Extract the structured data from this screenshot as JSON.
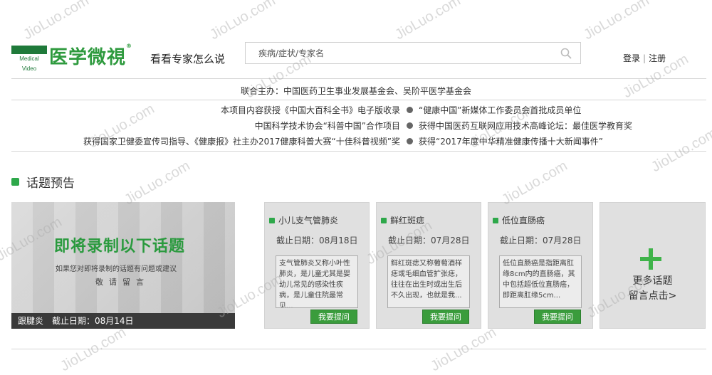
{
  "header": {
    "logo_small": "Medical Video",
    "logo_text": "医学微視",
    "logo_reg": "®",
    "slogan": "看看专家怎么说",
    "search_placeholder": "疾病/症状/专家名",
    "login": "登录",
    "auth_sep": "|",
    "register": "注册"
  },
  "hosts": "联合主办：中国医药卫生事业发展基金会、吴阶平医学基金会",
  "honors": [
    {
      "left": "本项目内容获授《中国大百科全书》电子版收录",
      "right": "“健康中国”新媒体工作委员会首批成员单位"
    },
    {
      "left": "中国科学技术协会“科普中国”合作项目",
      "right": "获得中国医药互联网应用技术高峰论坛：最佳医学教育奖"
    },
    {
      "left": "获得国家卫健委宣传司指导、《健康报》社主办2017健康科普大赛“十佳科普视频”奖",
      "right": "获得“2017年度中华精准健康传播十大新闻事件”"
    }
  ],
  "section": {
    "title": "话题预告"
  },
  "banner": {
    "headline": "即将录制以下话题",
    "subline": "如果您对即将录制的话题有问题或建议",
    "subline2": "敬请留言",
    "footer_topic": "跟腱炎",
    "footer_deadline": "截止日期：08月14日"
  },
  "cards": [
    {
      "title": "小儿支气管肺炎",
      "deadline": "截止日期：08月18日",
      "desc": "支气管肺炎又称小叶性肺炎，是儿童尤其是婴幼儿常见的感染性疾病，是儿童住院最常见...",
      "button": "我要提问"
    },
    {
      "title": "鲜红斑痣",
      "deadline": "截止日期：07月28日",
      "desc": "鲜红斑痣又称葡萄酒样痣或毛细血管扩张痣，往往在出生时或出生后不久出现，也就是我...",
      "button": "我要提问"
    },
    {
      "title": "低位直肠癌",
      "deadline": "截止日期：07月28日",
      "desc": "低位直肠癌是指距离肛缘8cm内的直肠癌，其中包括超低位直肠癌，即距离肛缘5cm...",
      "button": "我要提问"
    }
  ],
  "more": {
    "line1": "更多话题",
    "line2": "留言点击>"
  },
  "watermark_text": "JioLuo.com",
  "colors": {
    "brand_green": "#2ea84a",
    "button_green": "#3a9c3c"
  }
}
